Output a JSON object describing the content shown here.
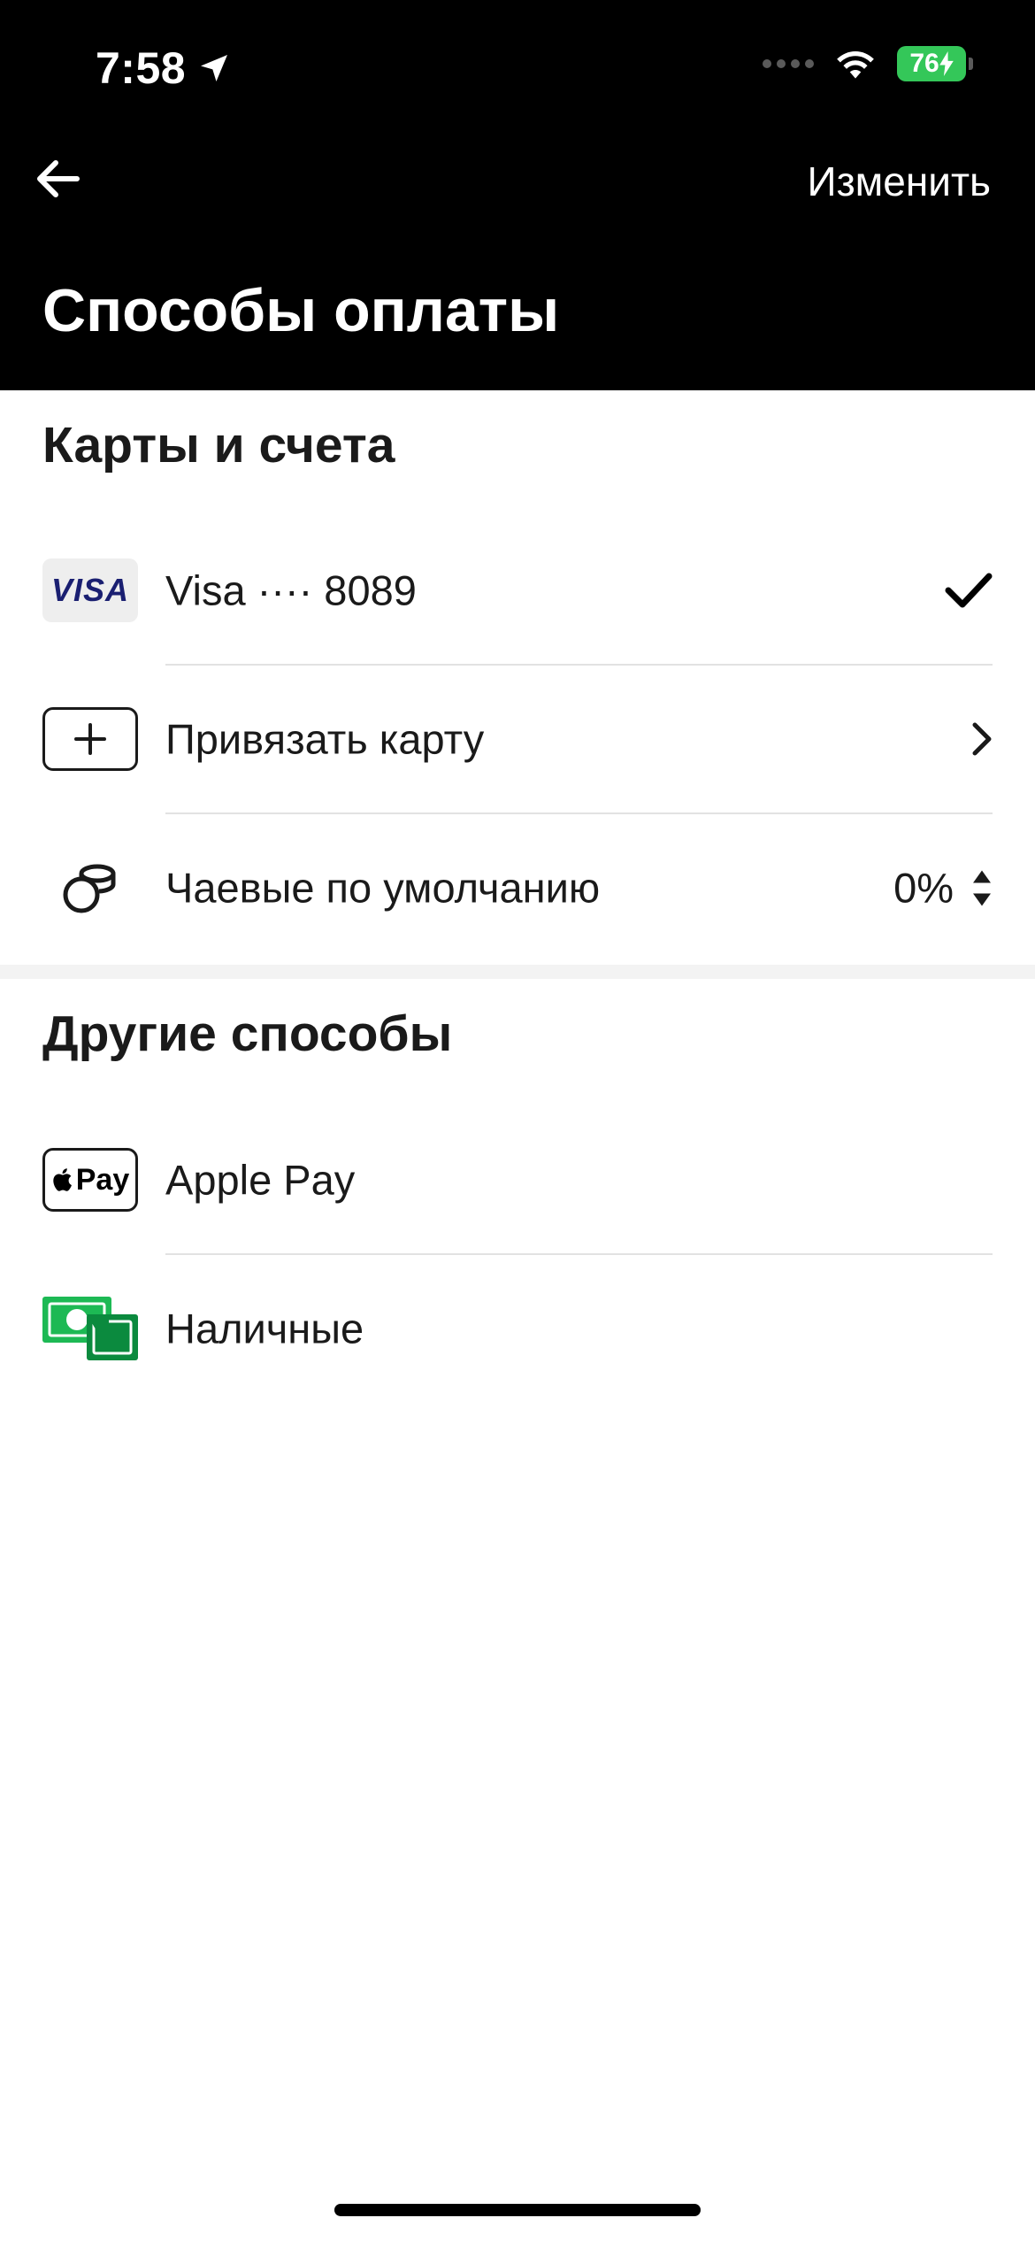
{
  "status_bar": {
    "time": "7:58",
    "battery": "76"
  },
  "nav": {
    "edit_label": "Изменить",
    "title": "Способы оплаты"
  },
  "cards_section": {
    "title": "Карты и счета",
    "visa_logo": "VISA",
    "visa_label": "Visa ···· 8089",
    "add_card_label": "Привязать карту",
    "tip_label": "Чаевые по умолчанию",
    "tip_value": "0%"
  },
  "other_section": {
    "title": "Другие способы",
    "apple_pay_logo": "Pay",
    "apple_pay_label": "Apple Pay",
    "cash_label": "Наличные"
  },
  "colors": {
    "header_bg": "#000000",
    "battery": "#34c759",
    "visa_blue": "#1a1f71",
    "cash_green": "#1db954"
  },
  "icons": [
    "location-arrow-icon",
    "wifi-icon",
    "back-arrow-icon",
    "checkmark-icon",
    "plus-icon",
    "chevron-right-icon",
    "coins-icon",
    "sort-arrows-icon",
    "apple-logo-icon",
    "cash-icon"
  ]
}
